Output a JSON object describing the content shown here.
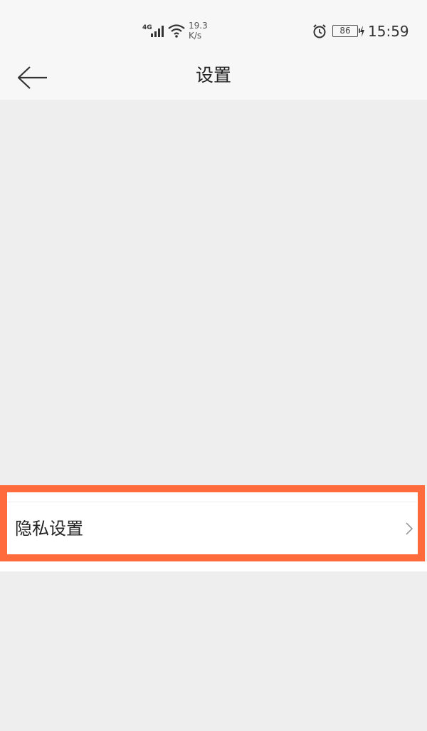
{
  "status_bar": {
    "network": "4G",
    "speed_value": "19.3",
    "speed_unit": "K/s",
    "battery_level": "86",
    "time": "15:59",
    "icons": [
      "signal-icon",
      "wifi-icon",
      "alarm-icon",
      "battery-icon",
      "charging-bolt-icon"
    ]
  },
  "header": {
    "title": "设置",
    "back_icon": "back-arrow-icon"
  },
  "settings": {
    "items": [
      {
        "label": "隐私设置",
        "icon": "chevron-right-icon"
      }
    ]
  },
  "colors": {
    "background": "#eeeeee",
    "header_background": "#f7f7f7",
    "highlight_frame": "#ff6b3d",
    "row_background": "#ffffff"
  }
}
